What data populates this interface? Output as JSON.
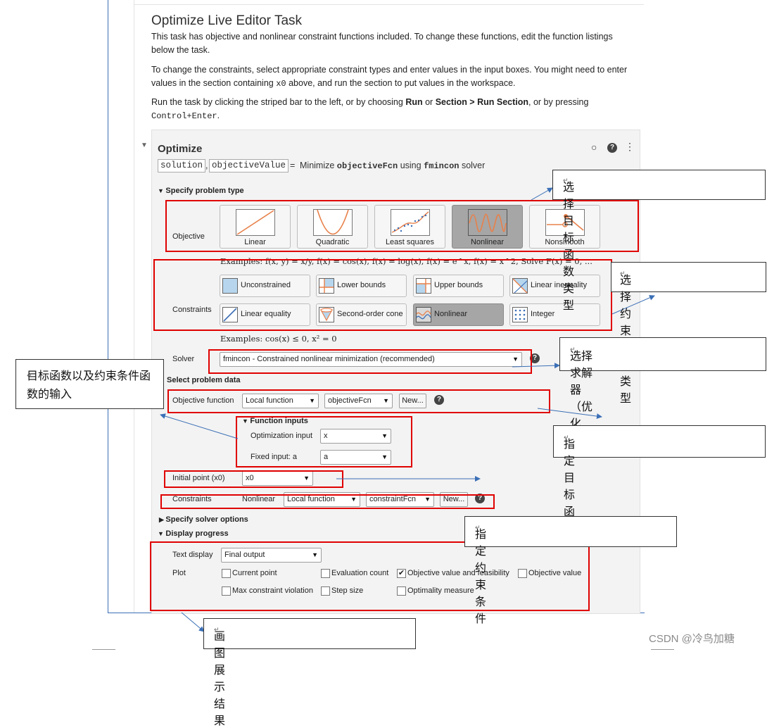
{
  "task": {
    "title": "Optimize Live Editor Task",
    "para1": "This task has objective and nonlinear constraint functions included. To change these functions, edit the function listings below the task.",
    "para2a": "To change the constraints, select appropriate constraint types and enter values in the input boxes. You might need to enter values in the section containing ",
    "para2_code": "x0",
    "para2b": " above, and run the section to put values in the workspace.",
    "para3a": "Run the task by clicking the striped bar to the left, or by choosing ",
    "para3_run": "Run",
    "para3b": " or ",
    "para3_section": "Section > Run Section",
    "para3c": ", or by pressing",
    "para3_key": "Control+Enter",
    "para3d": "."
  },
  "optimize": {
    "title": "Optimize",
    "output1": "solution",
    "comma": ",",
    "output2": "objectiveValue",
    "eq": "=",
    "summary_pre": "Minimize ",
    "summary_fcn": "objectiveFcn",
    "summary_mid": " using ",
    "summary_solver": "fmincon",
    "summary_post": " solver"
  },
  "problem_type": {
    "heading": "Specify problem type",
    "objective_label": "Objective",
    "objectives": [
      "Linear",
      "Quadratic",
      "Least squares",
      "Nonlinear",
      "Nonsmooth"
    ],
    "selected_objective": "Nonlinear",
    "objective_examples": "Examples: f(x, y) = x/y, f(x) = cos(x), f(x) = log(x), f(x) = e^x, f(x) = x^2, Solve F(x) = 0, ...",
    "constraints_label": "Constraints",
    "constraints": [
      "Unconstrained",
      "Lower bounds",
      "Upper bounds",
      "Linear inequality",
      "Linear equality",
      "Second-order cone",
      "Nonlinear",
      "Integer"
    ],
    "selected_constraint": "Nonlinear",
    "constraint_examples": "Examples: cos(x) ≤ 0, x² = 0",
    "solver_label": "Solver",
    "solver_value": "fmincon - Constrained nonlinear minimization (recommended)"
  },
  "problem_data": {
    "heading": "Select problem data",
    "objective_function_label": "Objective function",
    "objective_source": "Local function",
    "objective_fcn": "objectiveFcn",
    "new_label": "New...",
    "function_inputs_heading": "Function inputs",
    "optimization_input_label": "Optimization input",
    "optimization_input_value": "x",
    "fixed_input_label": "Fixed input: a",
    "fixed_input_value": "a",
    "initial_point_label": "Initial point (x0)",
    "initial_point_value": "x0",
    "constraints_label": "Constraints",
    "nonlinear_label": "Nonlinear",
    "constraint_source": "Local function",
    "constraint_fcn": "constraintFcn",
    "new_label2": "New..."
  },
  "solver_options": {
    "heading": "Specify solver options"
  },
  "display_progress": {
    "heading": "Display progress",
    "text_display_label": "Text display",
    "text_display_value": "Final output",
    "plot_label": "Plot",
    "plots": [
      {
        "label": "Current point",
        "checked": false
      },
      {
        "label": "Evaluation count",
        "checked": false
      },
      {
        "label": "Objective value and feasibility",
        "checked": true
      },
      {
        "label": "Objective value",
        "checked": false
      },
      {
        "label": "Max constraint violation",
        "checked": false
      },
      {
        "label": "Step size",
        "checked": false
      },
      {
        "label": "Optimality measure",
        "checked": false
      }
    ]
  },
  "annotations": {
    "objective_type": "选择目标函数类型",
    "constraint_type": "选择约束条件类型",
    "solver": "选择求解器（优化器）",
    "inputs": "目标函数以及约束条件函数的输入",
    "objective_fcn": "指定目标函数",
    "constraint_fcn": "指定约束条件",
    "plot": "画图展示结果",
    "para_mark": "↵"
  },
  "watermark": "CSDN @冷鸟加糖",
  "colors": {
    "annotation_red": "#e00000",
    "arrow_blue": "#3b6fb6",
    "selected_tile": "#a6a6a6",
    "plot_orange": "#e8804a",
    "plot_blue": "#3b6fb6"
  }
}
